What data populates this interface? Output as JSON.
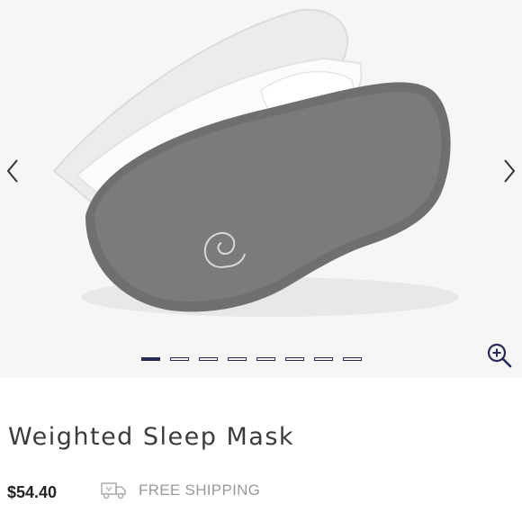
{
  "product": {
    "title": "Weighted Sleep Mask",
    "price": "$54.40",
    "shipping": "FREE SHIPPING"
  },
  "gallery": {
    "image_alt": "gray weighted sleep mask with white strap",
    "image_count": 8,
    "active_index": 0,
    "prev_icon": "chevron-left-icon",
    "next_icon": "chevron-right-icon",
    "zoom_icon": "zoom-in-icon"
  },
  "colors": {
    "accent": "#262a55",
    "price": "#222222",
    "muted": "#999999",
    "gallery_bg": "#f6f6f6"
  }
}
